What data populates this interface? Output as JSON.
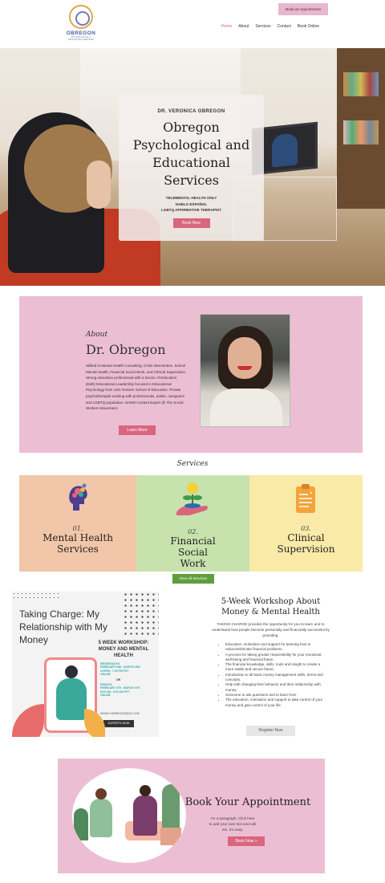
{
  "brand": {
    "logo_name": "OBREGON",
    "logo_sub": "PSYCHOLOGICAL &\nEDUCATIONAL SERVICES"
  },
  "header": {
    "book_button": "Book an Appointment",
    "nav": [
      "Home",
      "About",
      "Services",
      "Contact",
      "Book Online"
    ],
    "active_nav": "Home"
  },
  "hero": {
    "eyebrow": "DR. VERONICA OBREGON",
    "title": "Obregon Psychological and Educational Services",
    "tags": [
      "TELEMENTAL  HEALTH ONLY",
      "HABLO ESPAÑOL",
      "LGBTQ AFFIRMATIVE THERAPIST"
    ],
    "button": "Book Now"
  },
  "about": {
    "eyebrow": "About",
    "title": "Dr. Obregon",
    "body": "Skilled in Mental Health Consulting, Crisis Intervention, School Mental Health, Financial Social Work, and Clinical Supervision. Strong education professional with a Doctor of Education (EdD) Educational Leadership focused in Educational Psychology from USC Rossier School of Education. Private psychotherapist working with professionals, adults, caregivers and LGBTQ population. NASW Content Expert @ The Social Workers Movement.",
    "button": "Learn More"
  },
  "services": {
    "heading": "Services",
    "items": [
      {
        "num": "01.",
        "title": "Mental Health Services"
      },
      {
        "num": "02.",
        "title": "Financial Social Work"
      },
      {
        "num": "03.",
        "title": "Clinical Supervision"
      }
    ],
    "view_all": "View All Services"
  },
  "workshop_image": {
    "title": "Taking Charge: My Relationship with My Money",
    "subtitle": "5 WEEK WORKSHOP: MONEY AND MENTAL HEALTH",
    "dates_1": "WEDNESDAYS\nFEBRUARY 2ND - MARCH 2ND\n6:00PM - 7:00 PM PST\nONLINE",
    "dates_or": "OR",
    "dates_2": "FRIDAYS\nFEBRUARY 4TH - MARCH 4TH\n8:00 AM - 9:00 AM PST\nONLINE",
    "url": "WWW.VOBREGONEDD.COM",
    "button": "EXPERTS NOW"
  },
  "workshop": {
    "title": "5-Week Workshop About Money & Mental Health",
    "intro": "TAKING CHARGE provides the opportunity for you to learn and to understand how people become personally and financially successful by providing:",
    "bullets": [
      "Education, motivation and support for learning how to reduce/eliminate financial problems.",
      "A process for taking greater responsibility for your emotional well-being and financial future.",
      "The financial knowledge, skills, tools and insight to create a more stable and secure future.",
      "Introduction to all basic money management skills, terms and concepts.",
      "Help with changing their behavior and their relationship with money.",
      "Someone to ask questions and to learn from.",
      "The education, motivation and support to take control of your money and gain control of your life."
    ],
    "button": "Register Now"
  },
  "booking": {
    "title": "Book Your Appointment",
    "text": "I'm a paragraph. Click here to add your own text and edit me. It's easy.",
    "button": "Book Now  >"
  },
  "colors": {
    "accent_pink": "#d9657f",
    "section_pink": "#ecbed4",
    "peach": "#f2c6a8",
    "green": "#c8e2ad",
    "yellow": "#f9eaa8",
    "button_green": "#5f9e3c"
  }
}
